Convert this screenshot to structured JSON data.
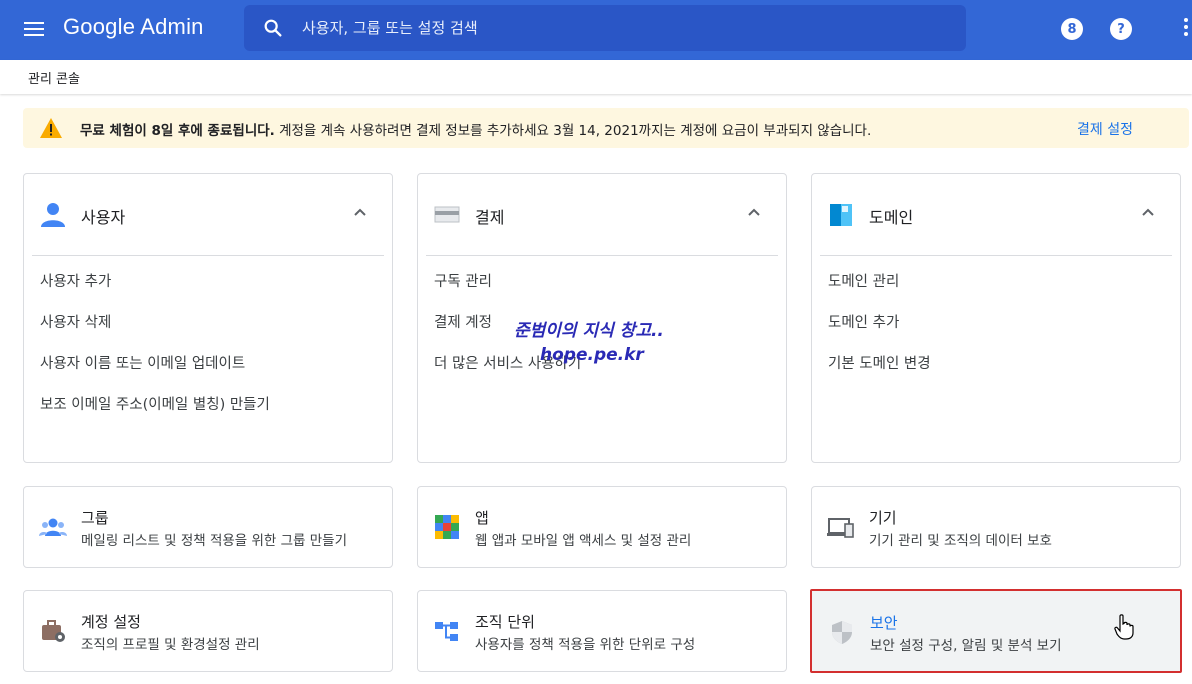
{
  "topbar": {
    "logo_text": "Google Admin",
    "search_placeholder": "사용자, 그룹 또는 설정 검색",
    "notification_badge": "8",
    "help_label": "?"
  },
  "breadcrumb": "관리 콘솔",
  "banner": {
    "bold_text": "무료 체험이 8일 후에 종료됩니다.",
    "text": " 계정을 계속 사용하려면 결제 정보를 추가하세요 3월 14, 2021까지는 계정에 요금이 부과되지 않습니다.",
    "link": "결제 설정"
  },
  "cards_big": [
    {
      "title": "사용자",
      "links": [
        "사용자 추가",
        "사용자 삭제",
        "사용자 이름 또는 이메일 업데이트",
        "보조 이메일 주소(이메일 별칭) 만들기"
      ]
    },
    {
      "title": "결제",
      "links": [
        "구독 관리",
        "결제 계정",
        "더 많은 서비스 사용하기"
      ]
    },
    {
      "title": "도메인",
      "links": [
        "도메인 관리",
        "도메인 추가",
        "기본 도메인 변경"
      ]
    }
  ],
  "cards_small": [
    {
      "title": "그룹",
      "desc": "메일링 리스트 및 정책 적용을 위한 그룹 만들기"
    },
    {
      "title": "앱",
      "desc": "웹 앱과 모바일 앱 액세스 및 설정 관리"
    },
    {
      "title": "기기",
      "desc": "기기 관리 및 조직의 데이터 보호"
    },
    {
      "title": "계정 설정",
      "desc": "조직의 프로필 및 환경설정 관리"
    },
    {
      "title": "조직 단위",
      "desc": "사용자를 정책 적용을 위한 단위로 구성"
    },
    {
      "title": "보안",
      "desc": "보안 설정 구성, 알림 및 분석 보기"
    }
  ],
  "watermark": {
    "line1": "준범이의 지식 창고..",
    "line2": "hope.pe.kr"
  },
  "colors": {
    "topbar": "#3367d6",
    "accent": "#1a73e8",
    "banner_bg": "#fef7e0",
    "highlight_border": "#d32f2f"
  }
}
